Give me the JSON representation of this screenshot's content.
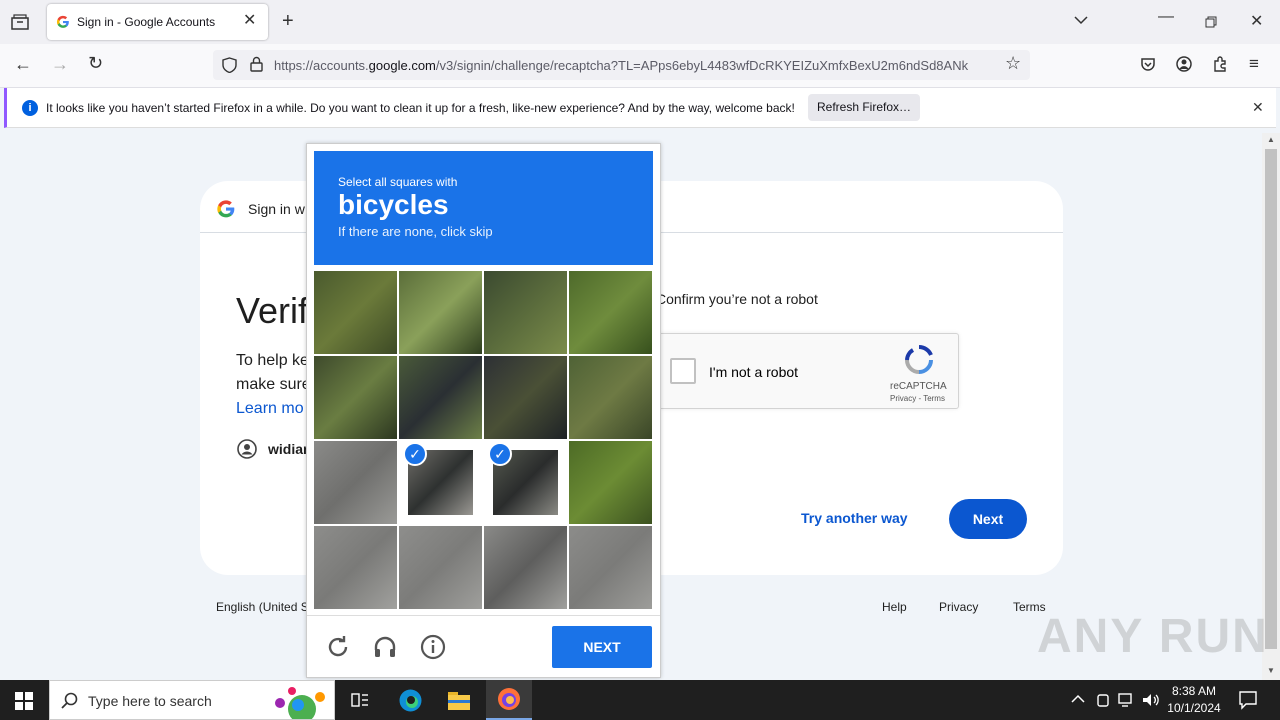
{
  "browser": {
    "tab_title": "Sign in - Google Accounts",
    "url_prefix": "https://accounts.",
    "url_domain": "google.com",
    "url_rest": "/v3/signin/challenge/recaptcha?TL=APps6ebyL4483wfDcRKYEIZuXmfxBexU2m6ndSd8ANk"
  },
  "notification": {
    "text": "It looks like you haven’t started Firefox in a while. Do you want to clean it up for a fresh, like-new experience? And by the way, welcome back!",
    "button": "Refresh Firefox…"
  },
  "page": {
    "header": "Sign in w",
    "heading": "Verif",
    "help_line1": "To help ke",
    "help_line2": "make sure",
    "learn_more": "Learn mo",
    "account": "widian",
    "confirm": "Confirm you’re not a robot",
    "recaptcha_label": "I'm not a robot",
    "recaptcha_brand": "reCAPTCHA",
    "recaptcha_links": "Privacy - Terms",
    "try_another": "Try another way",
    "next": "Next",
    "language": "English (United S",
    "footer_help": "Help",
    "footer_privacy": "Privacy",
    "footer_terms": "Terms"
  },
  "captcha": {
    "instruction": "Select all squares with",
    "target": "bicycles",
    "hint": "If there are none, click skip",
    "next": "NEXT",
    "selected_tiles": [
      9,
      10
    ]
  },
  "taskbar": {
    "search_placeholder": "Type here to search",
    "time": "8:38 AM",
    "date": "10/1/2024"
  },
  "watermark": "ANY RUN"
}
